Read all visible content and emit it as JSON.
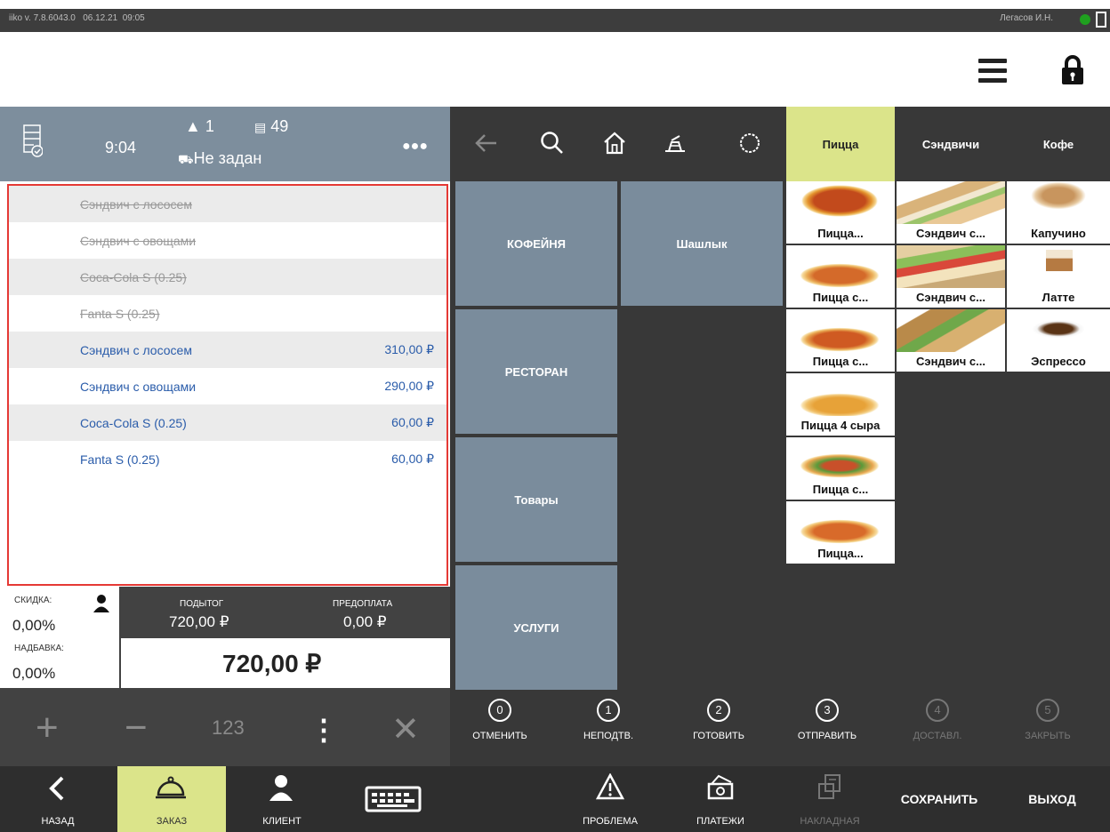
{
  "status_bar": {
    "version": "iiko v. 7.8.6043.0",
    "date": "06.12.21",
    "time": "09:05",
    "user": "Легасов И.Н."
  },
  "order_header": {
    "time": "9:04",
    "guests": "1",
    "order_number": "49",
    "delivery": "Не задан"
  },
  "order_items": [
    {
      "name": "Сэндвич с лососем",
      "price": "",
      "deleted": true
    },
    {
      "name": "Сэндвич с овощами",
      "price": "",
      "deleted": true
    },
    {
      "name": "Coca-Cola S (0.25)",
      "price": "",
      "deleted": true
    },
    {
      "name": "Fanta S (0.25)",
      "price": "",
      "deleted": true
    },
    {
      "name": "Сэндвич с лососем",
      "price": "310,00 ₽",
      "deleted": false
    },
    {
      "name": "Сэндвич с овощами",
      "price": "290,00 ₽",
      "deleted": false
    },
    {
      "name": "Coca-Cola S (0.25)",
      "price": "60,00 ₽",
      "deleted": false
    },
    {
      "name": "Fanta S (0.25)",
      "price": "60,00 ₽",
      "deleted": false
    }
  ],
  "totals": {
    "discount_label": "СКИДКА:",
    "discount_value": "0,00%",
    "surcharge_label": "НАДБАВКА:",
    "surcharge_value": "0,00%",
    "subtotal_label": "ПОДЫТОГ",
    "subtotal_value": "720,00 ₽",
    "prepay_label": "ПРЕДОПЛАТА",
    "prepay_value": "0,00 ₽",
    "total": "720,00 ₽"
  },
  "numpad": {
    "plus": "+",
    "minus": "−",
    "qty": "123",
    "more": "⋮",
    "remove": "✕"
  },
  "category_tabs": [
    {
      "label": "Пицца",
      "selected": true
    },
    {
      "label": "Сэндвичи",
      "selected": false
    },
    {
      "label": "Кофе",
      "selected": false
    }
  ],
  "groups": {
    "coffee_shop": "КОФЕЙНЯ",
    "shashlik": "Шашлык",
    "restaurant": "РЕСТОРАН",
    "goods": "Товары",
    "services": "УСЛУГИ"
  },
  "products": {
    "pizza": [
      "Пицца...",
      "Пицца с...",
      "Пицца с...",
      "Пицца 4 сыра",
      "Пицца с...",
      "Пицца..."
    ],
    "sandwich": [
      "Сэндвич с...",
      "Сэндвич с...",
      "Сэндвич с..."
    ],
    "coffee": [
      "Капучино",
      "Латте",
      "Эспрессо"
    ]
  },
  "steps": [
    {
      "num": "0",
      "label": "ОТМЕНИТЬ",
      "disabled": false
    },
    {
      "num": "1",
      "label": "НЕПОДТВ.",
      "disabled": false
    },
    {
      "num": "2",
      "label": "ГОТОВИТЬ",
      "disabled": false
    },
    {
      "num": "3",
      "label": "ОТПРАВИТЬ",
      "disabled": false
    },
    {
      "num": "4",
      "label": "ДОСТАВЛ.",
      "disabled": true
    },
    {
      "num": "5",
      "label": "ЗАКРЫТЬ",
      "disabled": true
    }
  ],
  "bottom_nav": {
    "back": "НАЗАД",
    "order": "ЗАКАЗ",
    "client": "КЛИЕНТ",
    "problem": "ПРОБЛЕМА",
    "payments": "ПЛАТЕЖИ",
    "invoice": "НАКЛАДНАЯ",
    "save": "СОХРАНИТЬ",
    "exit": "ВЫХОД"
  },
  "colors": {
    "accent": "#dbe48a",
    "header": "#7d8e9d",
    "group_tile": "#7a8c9c",
    "dark_bg": "#383838",
    "active_item": "#2a5caa",
    "selection_border": "#e53935",
    "online": "#1fa01f"
  }
}
